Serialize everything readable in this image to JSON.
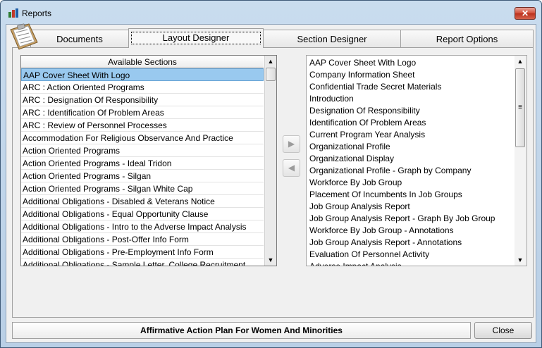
{
  "window": {
    "title": "Reports",
    "close_glyph": "✕",
    "icon": "reports-app-icon"
  },
  "tabs": [
    {
      "label": "Documents",
      "active": false
    },
    {
      "label": "Layout Designer",
      "active": true
    },
    {
      "label": "Section Designer",
      "active": false
    },
    {
      "label": "Report Options",
      "active": false
    }
  ],
  "available_sections": {
    "header": "Available Sections",
    "selected_index": 0,
    "items": [
      "AAP Cover Sheet With Logo",
      "ARC : Action Oriented Programs",
      "ARC : Designation Of Responsibility",
      "ARC : Identification Of Problem Areas",
      "ARC : Review of Personnel Processes",
      "Accommodation For Religious Observance And Practice",
      "Action Oriented Programs",
      "Action Oriented Programs - Ideal Tridon",
      "Action Oriented Programs - Silgan",
      "Action Oriented Programs - Silgan White Cap",
      "Additional Obligations - Disabled & Veterans Notice",
      "Additional Obligations - Equal Opportunity Clause",
      "Additional Obligations - Intro to the Adverse Impact Analysis",
      "Additional Obligations - Post-Offer Info Form",
      "Additional Obligations - Pre-Employment Info Form",
      "Additional Obligations - Sample Letter, College Recruitment"
    ]
  },
  "transfer": {
    "add_glyph": "▶",
    "remove_glyph": "◀"
  },
  "report_sections": {
    "items": [
      "AAP Cover Sheet With Logo",
      "Company Information Sheet",
      "Confidential Trade Secret Materials",
      "Introduction",
      "Designation Of Responsibility",
      "Identification Of Problem Areas",
      "Current Program Year Analysis",
      "Organizational Profile",
      "Organizational Display",
      "Organizational Profile  - Graph by Company",
      "Workforce By Job Group",
      "Placement Of Incumbents In Job Groups",
      "Job Group Analysis Report",
      "Job Group Analysis Report  - Graph By Job Group",
      "Workforce By Job Group - Annotations",
      "Job Group Analysis Report - Annotations",
      "Evaluation Of Personnel Activity",
      "Adverse Impact Analysis"
    ]
  },
  "footer": {
    "plan_name": "Affirmative Action Plan For Women And Minorities",
    "close_label": "Close"
  },
  "colors": {
    "selection": "#99c9ef",
    "title_gradient_top": "#c9dcee",
    "close_red": "#d14b36"
  }
}
